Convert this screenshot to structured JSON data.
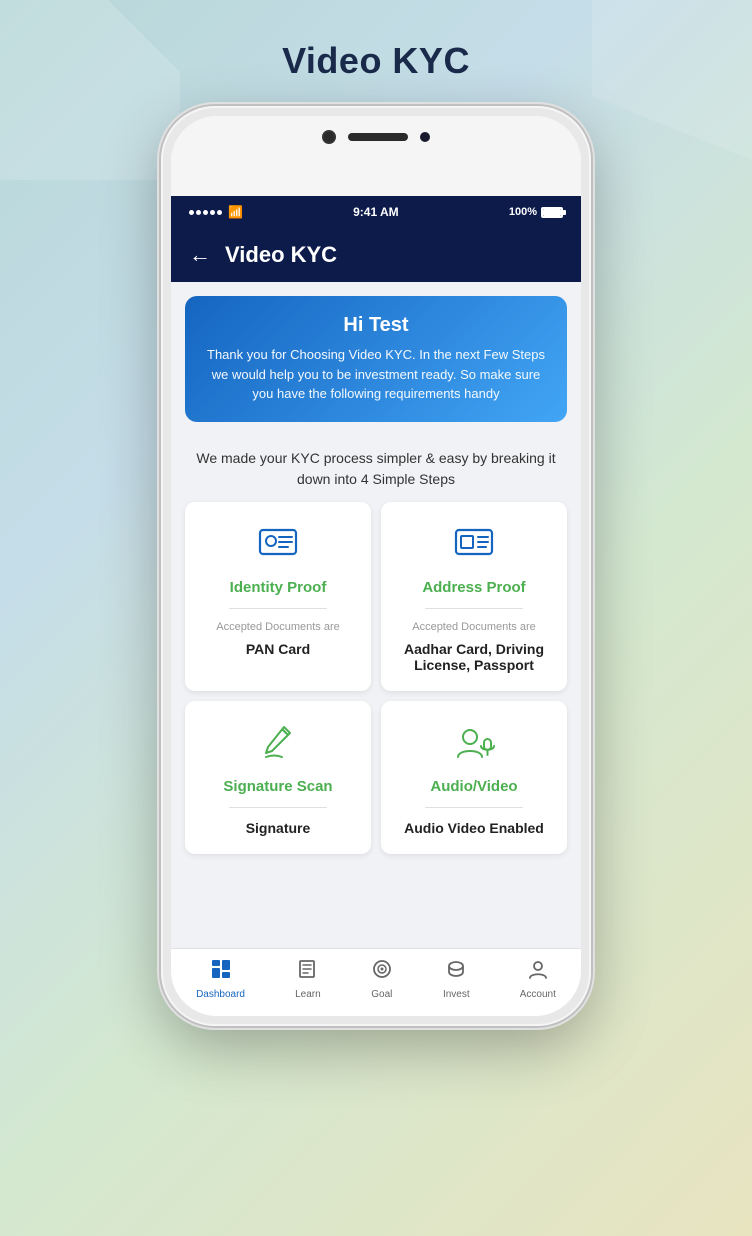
{
  "page": {
    "title": "Video KYC",
    "background_shape_left": true,
    "background_shape_right": true
  },
  "status_bar": {
    "signal": "•••••",
    "wifi": "wifi",
    "time": "9:41 AM",
    "battery_percent": "100%"
  },
  "app_header": {
    "back_label": "←",
    "title": "Video KYC"
  },
  "welcome_banner": {
    "greeting": "Hi Test",
    "message": "Thank you for Choosing Video KYC. In the next Few Steps we would help you to be investment ready. So make sure you have the following requirements handy"
  },
  "subtitle": "We made your KYC process simpler & easy by breaking it down into 4 Simple Steps",
  "steps": [
    {
      "id": "identity",
      "name": "Identity Proof",
      "docs_label": "Accepted Documents are",
      "docs_value": "PAN Card",
      "icon": "id-card"
    },
    {
      "id": "address",
      "name": "Address Proof",
      "docs_label": "Accepted Documents are",
      "docs_value": "Aadhar Card, Driving License, Passport",
      "icon": "address-card"
    },
    {
      "id": "signature",
      "name": "Signature Scan",
      "docs_label": "",
      "docs_value": "Signature",
      "icon": "signature"
    },
    {
      "id": "audio-video",
      "name": "Audio/Video",
      "docs_label": "",
      "docs_value": "Audio Video Enabled",
      "icon": "av"
    }
  ],
  "bottom_nav": [
    {
      "id": "dashboard",
      "label": "Dashboard",
      "icon": "dashboard",
      "active": true
    },
    {
      "id": "learn",
      "label": "Learn",
      "icon": "learn",
      "active": false
    },
    {
      "id": "goal",
      "label": "Goal",
      "icon": "goal",
      "active": false
    },
    {
      "id": "invest",
      "label": "Invest",
      "icon": "invest",
      "active": false
    },
    {
      "id": "account",
      "label": "Account",
      "icon": "account",
      "active": false
    }
  ]
}
